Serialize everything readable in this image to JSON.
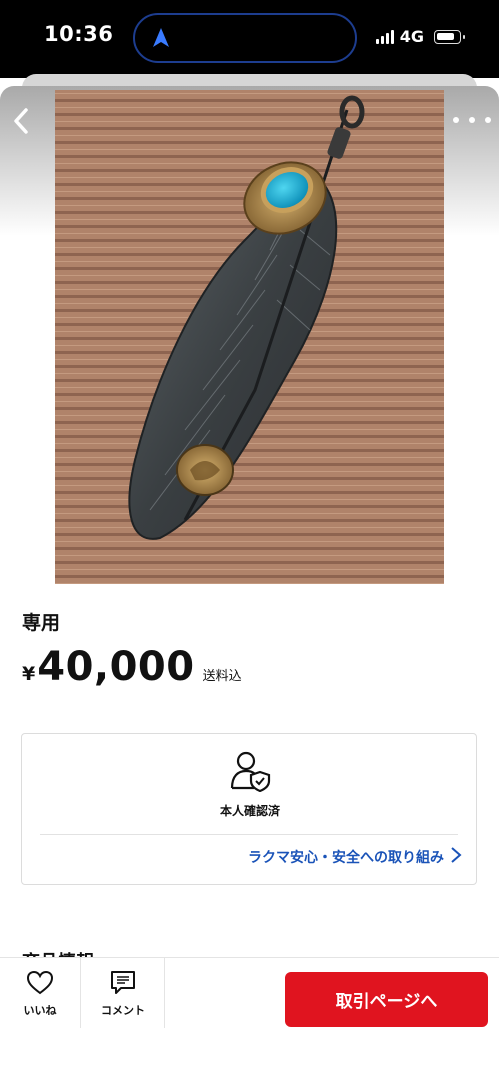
{
  "status_bar": {
    "time": "10:36",
    "network": "4G"
  },
  "item": {
    "title": "専用",
    "currency": "¥",
    "price": "40,000",
    "shipping": "送料込"
  },
  "verification": {
    "label": "本人確認済",
    "safety_link": "ラクマ安心・安全への取り組み"
  },
  "section": {
    "product_info": "商品情報"
  },
  "bottom_bar": {
    "like_label": "いいね",
    "comment_label": "コメント",
    "cta_label": "取引ページへ"
  },
  "colors": {
    "accent_red": "#e0141f",
    "link_blue": "#1a53b8"
  },
  "icons": [
    "navigation-arrow-icon",
    "signal-icon",
    "battery-icon",
    "back-chevron-icon",
    "more-dots-icon",
    "user-shield-icon",
    "chevron-right-icon",
    "heart-icon",
    "comment-icon"
  ]
}
